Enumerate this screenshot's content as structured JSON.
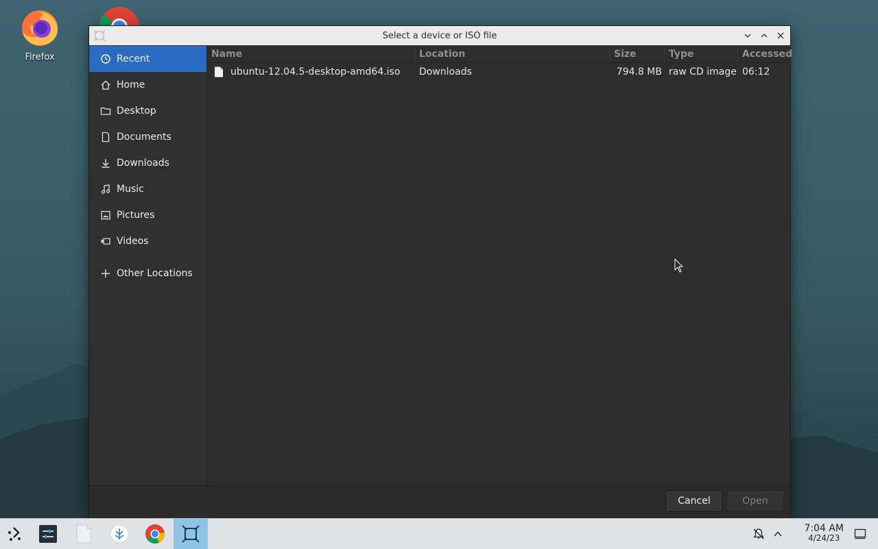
{
  "desktop": {
    "icons": [
      {
        "label": "Firefox",
        "icon": "firefox-icon"
      },
      {
        "label": "",
        "icon": "chrome-icon"
      }
    ]
  },
  "dialog": {
    "title": "Select a device or ISO file",
    "window_buttons": [
      "minimize-icon",
      "maximize-icon",
      "close-icon"
    ]
  },
  "sidebar": {
    "items": [
      {
        "label": "Recent",
        "icon": "clock-icon",
        "active": true
      },
      {
        "label": "Home",
        "icon": "home-icon"
      },
      {
        "label": "Desktop",
        "icon": "folder-icon"
      },
      {
        "label": "Documents",
        "icon": "document-icon"
      },
      {
        "label": "Downloads",
        "icon": "download-icon"
      },
      {
        "label": "Music",
        "icon": "music-icon"
      },
      {
        "label": "Pictures",
        "icon": "picture-icon"
      },
      {
        "label": "Videos",
        "icon": "video-icon"
      }
    ],
    "other": {
      "label": "Other Locations",
      "icon": "plus-icon"
    }
  },
  "filelist": {
    "columns": [
      "Name",
      "Location",
      "Size",
      "Type",
      "Accessed"
    ],
    "rows": [
      {
        "name": "ubuntu-12.04.5-desktop-amd64.iso",
        "location": "Downloads",
        "size": "794.8 MB",
        "type": "raw CD image",
        "accessed": "06:12",
        "icon": "file-icon"
      }
    ]
  },
  "footer": {
    "cancel_label": "Cancel",
    "open_label": "Open"
  },
  "taskbar": {
    "items": [
      "app-launcher-icon",
      "settings-icon",
      "files-icon",
      "discover-icon",
      "chrome-icon",
      "dialog-window-icon"
    ],
    "tray": [
      "notification-bell-icon",
      "tray-expand-icon",
      "show-desktop-icon"
    ],
    "time": "7:04 AM",
    "date": "4/24/23"
  },
  "colors": {
    "accent": "#2a6cc1",
    "taskbar_active": "#8fc4e6"
  }
}
